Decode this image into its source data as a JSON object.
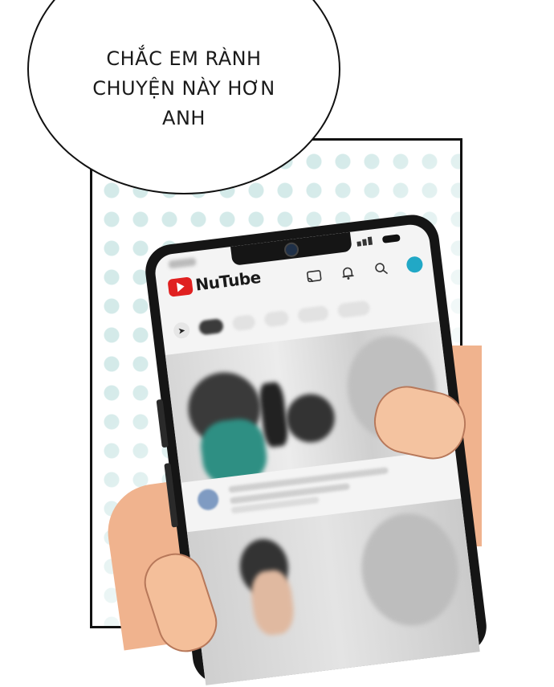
{
  "speech_bubble": {
    "text": "CHẮC EM RÀNH\nCHUYỆN NÀY HƠN\nANH"
  },
  "phone_app": {
    "logo_text": "NuTube",
    "logo_color": "#e02020",
    "header_icons": [
      "cast-icon",
      "bell-icon",
      "search-icon",
      "avatar"
    ],
    "chips": [
      "explore-icon",
      "chip-all",
      "chip-1",
      "chip-2",
      "chip-3",
      "chip-4"
    ]
  },
  "colors": {
    "dot_pattern": "#cfe8e7",
    "skin": "#f0b38e",
    "phone_body": "#151515"
  }
}
